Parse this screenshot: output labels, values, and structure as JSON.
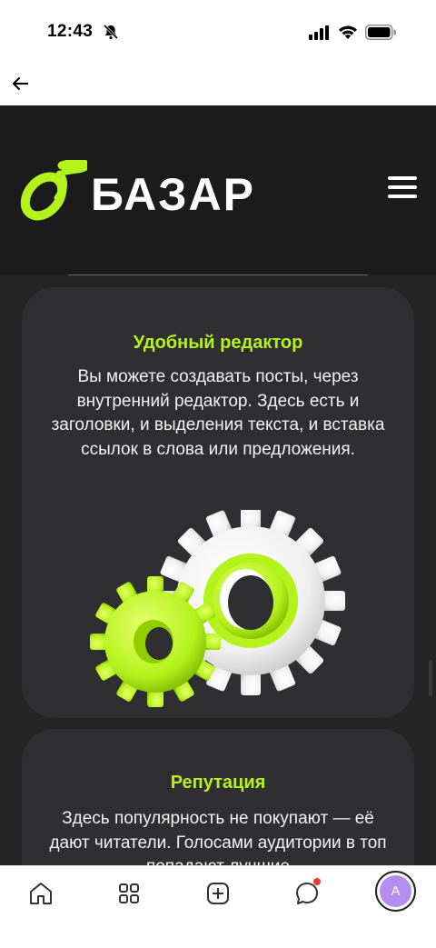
{
  "status_bar": {
    "time": "12:43"
  },
  "header": {
    "logo_text": "БАЗАР"
  },
  "cards": [
    {
      "title": "Удобный редактор",
      "text": "Вы можете создавать посты, через внутренний редактор. Здесь есть и заголовки, и выделения текста, и вставка ссылок в слова или предложения."
    },
    {
      "title": "Репутация",
      "text": "Здесь популярность не покупают — её дают читатели. Голосами аудитории в топ попадают лучшие"
    }
  ],
  "tab_bar": {
    "avatar_letter": "A"
  },
  "colors": {
    "accent": "#b4f21c",
    "header_bg": "#1b1b1b",
    "card_bg": "#2f2f31",
    "avatar_bg": "#b58cf0",
    "notification": "#f03a3a"
  },
  "icons": [
    "mute-icon",
    "signal-icon",
    "wifi-icon",
    "battery-icon",
    "back-arrow-icon",
    "menu-icon",
    "gears-illustration",
    "home-icon",
    "grid-icon",
    "add-icon",
    "chat-icon"
  ]
}
